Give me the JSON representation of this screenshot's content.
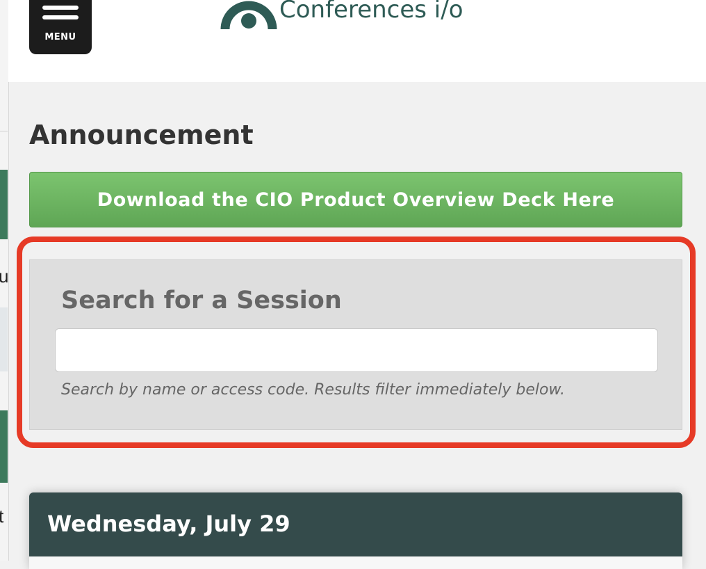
{
  "header": {
    "menu_label": "MENU",
    "logo_text": "Conferences i/o",
    "brand_color": "#2e5b55"
  },
  "announcement": {
    "heading": "Announcement",
    "button_label": "Download the CIO Product Overview Deck Here",
    "button_color": "#6ab45f"
  },
  "search": {
    "title": "Search for a Session",
    "input_value": "",
    "help_text": "Search by name or access code. Results filter immediately below.",
    "highlight_color": "#e63a26"
  },
  "schedule": {
    "day_heading": "Wednesday, July 29",
    "card_color": "#344b4b"
  },
  "background_page": {
    "fragment_1": "u",
    "fragment_2": "t"
  }
}
